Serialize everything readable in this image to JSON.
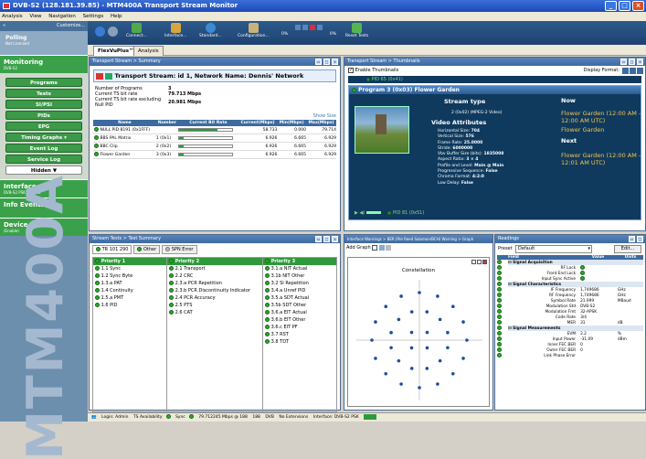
{
  "window": {
    "title": "DVB-S2 (128.181.39.85) - MTM400A Transport Stream Monitor"
  },
  "menu": [
    "Analysis",
    "View",
    "Navigation",
    "Settings",
    "Help"
  ],
  "left": {
    "customize": "Customize...",
    "polling": "Polling",
    "polling_sub": "Not Licensed",
    "monitoring": "Monitoring",
    "monitoring_sub": "DVB-S2",
    "nav": [
      "Programs",
      "Tests",
      "SI/PSI",
      "PIDs",
      "EPG",
      "Timing Graphs",
      "Event Log",
      "Service Log"
    ],
    "hidden": "Hidden",
    "interface": "Interface",
    "interface_sub": "DVB-S2 PSK: Locked",
    "info": "Info Events",
    "device": "Device",
    "device_sub": "(Enable)",
    "brand": "MTM400A"
  },
  "toolbar": {
    "connect": "Connect...",
    "interface": "Interface...",
    "standard": "Standard...",
    "configuration": "Configuration...",
    "reset": "Reset Tests",
    "speed_lo": "0%",
    "speed_hi": "0%"
  },
  "tabs": [
    "FlexVuPlus™",
    "Analysis"
  ],
  "ts": {
    "panel_title": "Transport Stream > Summary",
    "header": "Transport Stream: id 1, Network Name: Dennis' Network",
    "rows": [
      [
        "Number of Programs",
        "3"
      ],
      [
        "Current TS bit rate",
        "79.713 Mbps"
      ],
      [
        "Current TS bit rate excluding Null PID",
        "20.981 Mbps"
      ]
    ],
    "show_size": "Show Size",
    "cols": [
      "Name",
      "Number",
      "Current Bit Rate",
      "Current(Mbps)",
      "Min(Mbps)",
      "Max(Mbps)"
    ],
    "programs": [
      {
        "name": "NULL PID 8191 (0x1FFF)",
        "num": "",
        "bar": 0.73,
        "cur": "58.733",
        "min": "0.000",
        "max": "79.714"
      },
      {
        "name": "BBS PAL Matrix",
        "num": "1 (0x1)",
        "bar": 0.09,
        "cur": "6.926",
        "min": "6.665",
        "max": "6.929"
      },
      {
        "name": "BBC Clip",
        "num": "2 (0x2)",
        "bar": 0.09,
        "cur": "6.926",
        "min": "6.665",
        "max": "6.929"
      },
      {
        "name": "Flower Garden",
        "num": "3 (0x3)",
        "bar": 0.09,
        "cur": "6.926",
        "min": "6.665",
        "max": "6.929"
      }
    ]
  },
  "thumbs": {
    "panel_title": "Transport Stream > Thumbnails",
    "enable": "Enable Thumbnails",
    "display_format": "Display Format:",
    "pid_top": "PID 65 (0x41)",
    "program": "Program 3 (0x03) Flower Garden",
    "stream_type": "Stream type",
    "stream_value": "2 (0x02) (MPEG-2 Video)",
    "video_attr": "Video Attributes",
    "attrs": [
      [
        "Horizontal Size:",
        "704"
      ],
      [
        "Vertical Size:",
        "576"
      ],
      [
        "Frame Rate:",
        "25.0000"
      ],
      [
        "Stride:",
        "6000000"
      ],
      [
        "Vbv Buffer Size (bits):",
        "1835008"
      ],
      [
        "Aspect Ratio:",
        "3 × 4"
      ],
      [
        "Profile and Level:",
        "Main @ Main"
      ],
      [
        "Progressive Sequence:",
        "False"
      ],
      [
        "Chroma Format:",
        "4:2:0"
      ],
      [
        "Low Delay:",
        "False"
      ]
    ],
    "now": "Now",
    "now_title": "Flower Garden (12:00 AM - 12:00 AM UTC)",
    "now_sub": "Flower Garden",
    "next": "Next",
    "next_title": "Flower Garden (12:00 AM - 12:01 AM UTC)",
    "pid_bottom": "PID 81 (0x51)"
  },
  "tests": {
    "panel_title": "Stream Tests > Test Summary",
    "tabs": [
      "TR 101 290",
      "Other",
      "SPN Error"
    ],
    "p1": {
      "title": "Priority 1",
      "items": [
        "1.1 Sync",
        "1.2 Sync Byte",
        "1.3.a PAT",
        "1.4 Continuity",
        "1.5.a PMT",
        "1.6 PID"
      ]
    },
    "p2": {
      "title": "Priority 2",
      "items": [
        "2.1 Transport",
        "2.2 CRC",
        "2.3.a PCR Repetition",
        "2.3.b PCR Discontinuity Indicator",
        "2.4 PCR Accuracy",
        "2.5 PTS",
        "2.6 CAT"
      ]
    },
    "p3": {
      "title": "Priority 3",
      "items": [
        "3.1.a NIT Actual",
        "3.1b NIT Other",
        "3.2 SI Repetition",
        "3.4.a Unref PID",
        "3.5.a SDT Actual",
        "3.5b SDT Other",
        "3.6.a EIT Actual",
        "3.6.b EIT Other",
        "3.6.c EIT PF",
        "3.7 RST",
        "3.8 TDT"
      ]
    }
  },
  "constellation": {
    "panel_title": "Interface Warnings > BER (Pre Reed Solomon/BCH) Warning > Graph",
    "add_graph": "Add Graph",
    "title": "Constellation"
  },
  "readings": {
    "panel_title": "Readings",
    "preset_label": "Preset",
    "preset_value": "Default",
    "edit": "Edit...",
    "cols": [
      "Field",
      "Value",
      "Units"
    ],
    "groups": [
      {
        "name": "Signal Acquisition",
        "rows": [
          [
            "RF Lock",
            "lamp",
            ""
          ],
          [
            "Front End Lock",
            "lamp",
            ""
          ],
          [
            "Input Sync Active",
            "lamp",
            ""
          ]
        ]
      },
      {
        "name": "Signal Characteristics",
        "rows": [
          [
            "IF Frequency",
            "1,749686",
            "GHz"
          ],
          [
            "RF Frequency",
            "1,749686",
            "GHz"
          ],
          [
            "Symbol Rate",
            "21.999",
            "MBaud"
          ],
          [
            "Modulation Std",
            "DVB-S2",
            ""
          ],
          [
            "Modulation Fmt",
            "32-APSK",
            ""
          ],
          [
            "Code Rate",
            "3/4",
            ""
          ],
          [
            "MER",
            "31",
            "dB"
          ]
        ]
      },
      {
        "name": "Signal Measurements",
        "rows": [
          [
            "EVM",
            "2.2",
            "%"
          ],
          [
            "Input Power",
            "-31.09",
            "dBm"
          ],
          [
            "Inner FEC BER",
            "0",
            ""
          ],
          [
            "Outer FEC BER",
            "0",
            ""
          ],
          [
            "Link Phase Error",
            "",
            ""
          ]
        ]
      }
    ]
  },
  "status": {
    "login": "Login: Admin",
    "ts": "TS Availability",
    "sync": "Sync",
    "rate": "79.712245 Mbps @ 188",
    "size": "188",
    "std": "DVB",
    "ext": "No Extensions",
    "iface": "Interface: DVB-S2 PSK"
  }
}
